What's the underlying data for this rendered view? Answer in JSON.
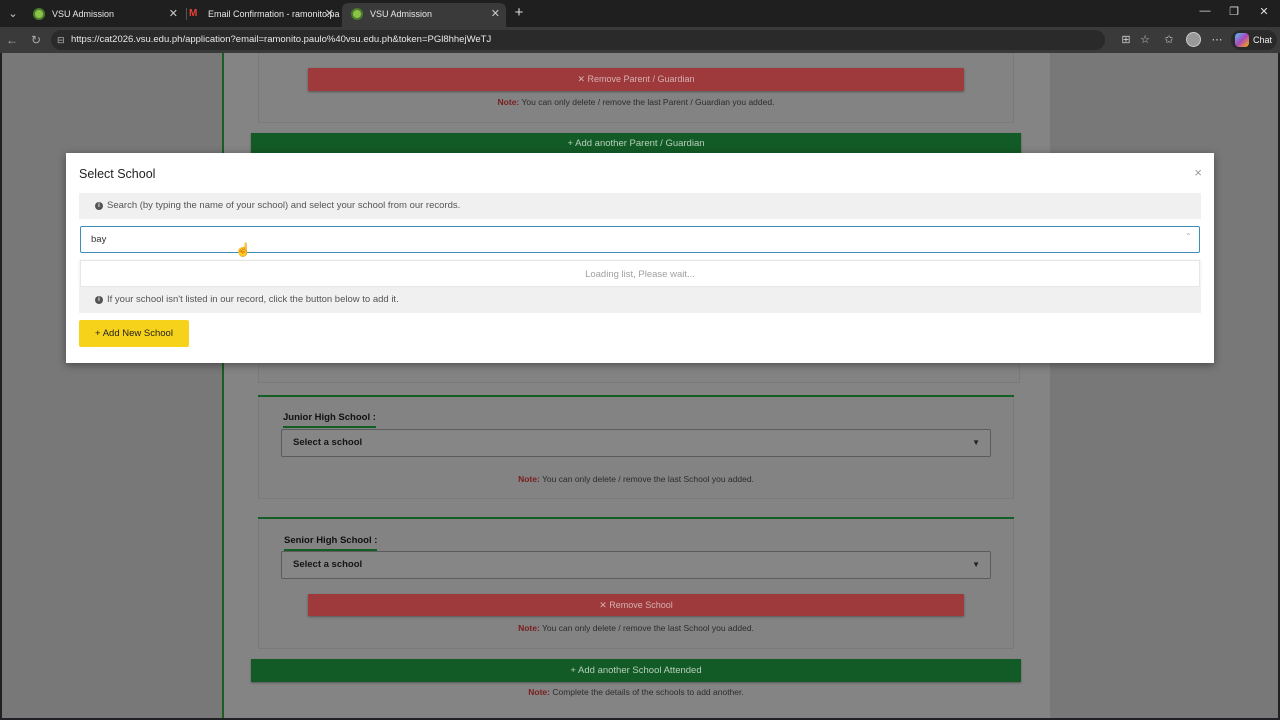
{
  "browser": {
    "tabs": [
      {
        "title": "VSU Admission",
        "active": false
      },
      {
        "title": "Email Confirmation - ramonito.pa",
        "active": false
      },
      {
        "title": "VSU Admission",
        "active": true
      }
    ],
    "url": "https://cat2026.vsu.edu.ph/application?email=ramonito.paulo%40vsu.edu.ph&token=PGl8hhejWeTJ",
    "chat_label": "Chat"
  },
  "page": {
    "parent_section": {
      "remove_label": "✕ Remove Parent / Guardian",
      "note_prefix": "Note:",
      "note_text": "You can only delete / remove the last Parent / Guardian you added.",
      "add_label": "+ Add another Parent / Guardian"
    },
    "junior_high": {
      "label": "Junior High School :",
      "select_value": "Select a school",
      "note_prefix": "Note:",
      "note_text": "You can only delete / remove the last School you added."
    },
    "senior_high": {
      "label": "Senior High School :",
      "select_value": "Select a school",
      "remove_label": "✕ Remove School",
      "note_prefix": "Note:",
      "note_text": "You can only delete / remove the last School you added."
    },
    "add_school_label": "+ Add another School Attended",
    "bottom_note_prefix": "Note:",
    "bottom_note_text": "Complete the details of the schools to add another."
  },
  "modal": {
    "title": "Select School",
    "close": "×",
    "info_search": "Search (by typing the name of your school) and select your school from our records.",
    "search_value": "bay",
    "loading_text": "Loading list, Please wait...",
    "info_add": "If your school isn't listed in our record, click the button below to add it.",
    "add_button_label": "+ Add New School"
  },
  "colors": {
    "primary_green": "#1b8a3a",
    "danger_red": "#dc3545",
    "warning_yellow": "#f7d21a",
    "focus_blue": "#3f8fb4"
  }
}
